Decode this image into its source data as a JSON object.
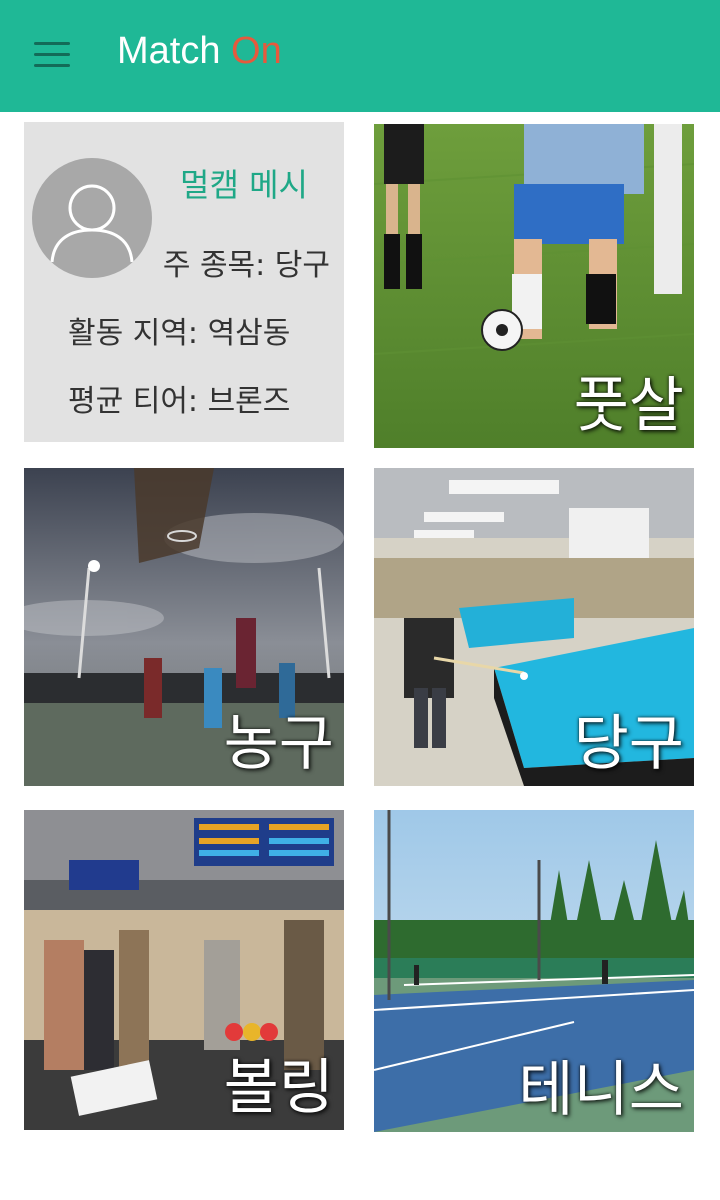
{
  "app": {
    "title_main": "Match ",
    "title_accent": "On",
    "colors": {
      "appbar": "#1fb896",
      "accent": "#e55a3d",
      "name": "#1fa887"
    },
    "menu_icon": "hamburger-menu-icon"
  },
  "profile": {
    "name": "멀캠 메시",
    "main_sport": "주 종목: 당구",
    "region": "활동 지역: 역삼동",
    "tier": "평균 티어: 브론즈",
    "avatar_icon": "user-silhouette-icon"
  },
  "sports": [
    {
      "id": "futsal",
      "label": "풋살"
    },
    {
      "id": "basketball",
      "label": "농구"
    },
    {
      "id": "billiards",
      "label": "당구"
    },
    {
      "id": "bowling",
      "label": "볼링"
    },
    {
      "id": "tennis",
      "label": "테니스"
    }
  ]
}
